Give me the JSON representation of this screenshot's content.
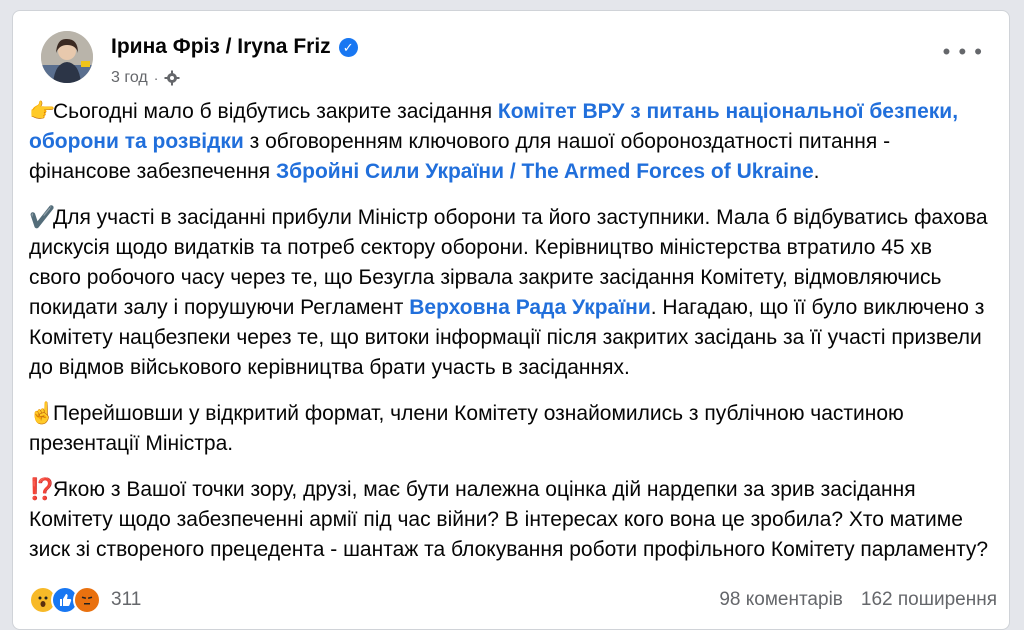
{
  "post": {
    "author": "Ірина Фріз / Iryna Friz",
    "time": "3 год",
    "separator": "·"
  },
  "body": {
    "p1": {
      "emoji": "👉",
      "text1": "Сьогодні мало б відбутись закрите засідання ",
      "link1": "Комітет ВРУ з питань національної безпеки, оборони та розвідки",
      "text2": " з обговоренням ключового для нашої обороноздатності питання - фінансове забезпечення ",
      "link2": "Збройні Сили України / The Armed Forces of Ukraine",
      "text3": "."
    },
    "p2": {
      "emoji": "✔️",
      "text1": "Для участі в засіданні прибули Міністр оборони та його заступники. Мала б відбуватись фахова дискусія щодо видатків та потреб сектору оборони. Керівництво міністерства втратило 45 хв свого робочого часу через те, що Безугла зірвала закрите засідання Комітету, відмовляючись покидати залу і порушуючи Регламент ",
      "link1": "Верховна Рада України",
      "text2": ". Нагадаю, що її було виключено з Комітету нацбезпеки через те, що витоки інформації після закритих засідань за її участі призвели до відмов військового керівництва брати участь в засіданнях."
    },
    "p3": {
      "emoji": "☝️",
      "text1": "Перейшовши у відкритий формат, члени Комітету ознайомились з публічною частиною презентації Міністра."
    },
    "p4": {
      "emoji": "⁉️",
      "text1": "Якою з Вашої  точки зору, друзі, має бути належна оцінка дій нардепки за зрив засідання Комітету щодо забезпеченні армії під час війни? В інтересах кого вона це зробила? Хто матиме зиск зі створеного прецедента - шантаж та блокування роботи профільного Комітету парламенту?"
    }
  },
  "footer": {
    "reaction_count": "311",
    "comments": "98 коментарів",
    "shares": "162 поширення",
    "reaction_icons": [
      "wow-icon",
      "like-icon",
      "angry-icon"
    ]
  },
  "colors": {
    "link": "#216fdb",
    "text": "#050505",
    "muted": "#65676b",
    "verified": "#1877f2"
  }
}
